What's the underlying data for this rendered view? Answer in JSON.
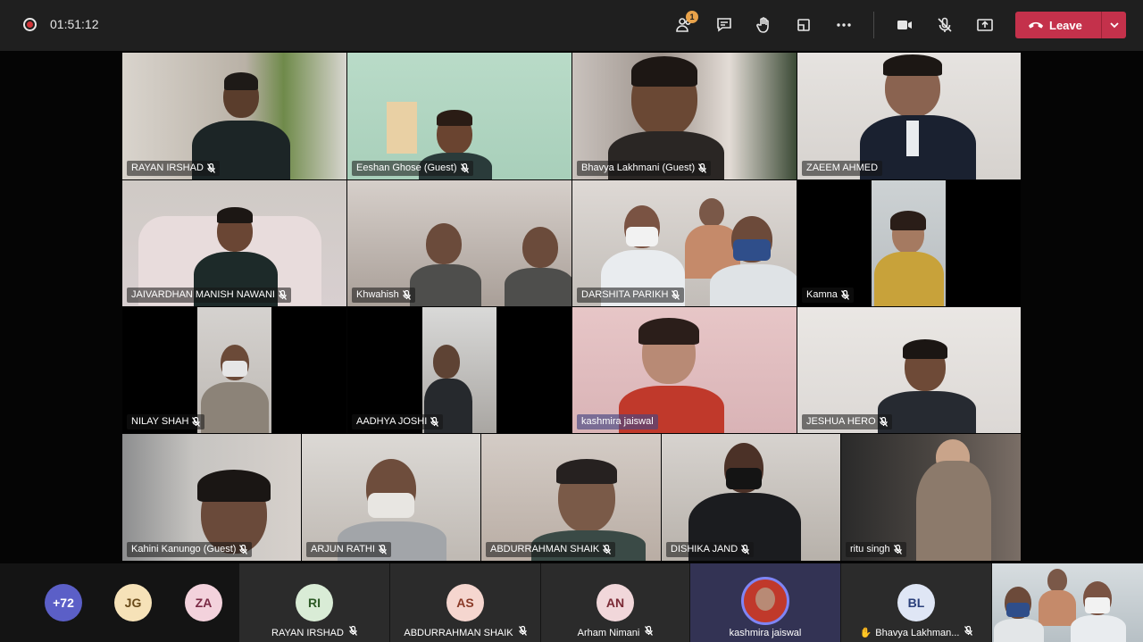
{
  "meeting": {
    "elapsed": "01:51:12",
    "toolbar": {
      "participants_badge": "1",
      "leave_label": "Leave",
      "icons": [
        "participants-icon",
        "chat-icon",
        "raise-hand-icon",
        "share-tray-icon",
        "more-icon",
        "camera-icon",
        "mic-off-icon",
        "share-screen-icon",
        "phone-hangup-icon",
        "chevron-down-icon"
      ]
    },
    "grid": [
      {
        "name": "RAYAN IRSHAD",
        "muted": true
      },
      {
        "name": "Eeshan Ghose (Guest)",
        "muted": true
      },
      {
        "name": "Bhavya Lakhmani (Guest)",
        "muted": true
      },
      {
        "name": "ZAEEM AHMED",
        "muted": false
      },
      {
        "name": "JAIVARDHAN MANISH NAWANI",
        "muted": true
      },
      {
        "name": "Khwahish",
        "muted": true
      },
      {
        "name": "DARSHITA PARIKH",
        "muted": true
      },
      {
        "name": "Kamna",
        "muted": true
      },
      {
        "name": "NILAY SHAH",
        "muted": true
      },
      {
        "name": "AADHYA JOSHI",
        "muted": true
      },
      {
        "name": "kashmira jaiswal",
        "muted": false,
        "active_speaker": true
      },
      {
        "name": "JESHUA HERO",
        "muted": true
      },
      {
        "name": "Kahini  Kanungo (Guest)",
        "muted": true
      },
      {
        "name": "ARJUN RATHI",
        "muted": true
      },
      {
        "name": "ABDURRAHMAN SHAIK",
        "muted": true
      },
      {
        "name": "DISHIKA JAND",
        "muted": true
      },
      {
        "name": "ritu singh",
        "muted": true
      }
    ],
    "strip": {
      "overflow_count": "+72",
      "small_avatars": [
        {
          "initials": "JG",
          "color": "#f6e2b8"
        },
        {
          "initials": "ZA",
          "color": "#f3d2dc"
        }
      ],
      "tiles": [
        {
          "initials": "RI",
          "name": "RAYAN IRSHAD",
          "color": "#d9ecd6"
        },
        {
          "initials": "AS",
          "name": "ABDURRAHMAN SHAIK",
          "color": "#f5d6cf"
        },
        {
          "initials": "AN",
          "name": "Arham Nimani",
          "color": "#f1d7da"
        },
        {
          "initials": "",
          "name": "kashmira jaiswal",
          "color": "#c0392b"
        },
        {
          "initials": "BL",
          "name": "Bhavya Lakhman...",
          "color": "#dfe6f5"
        }
      ]
    }
  }
}
